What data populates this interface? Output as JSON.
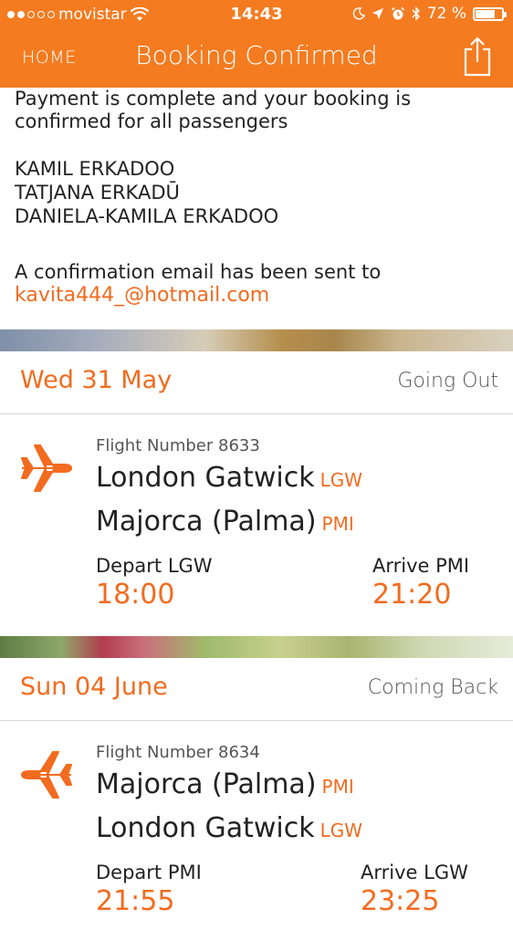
{
  "status_bar": {
    "carrier": "movistar",
    "time": "14:43",
    "battery": "72 %"
  },
  "nav": {
    "home_label": "HOME",
    "title": "Booking Confirmed"
  },
  "confirmation": {
    "message": "Payment is complete and your booking is confirmed for all passengers",
    "passengers": [
      "KAMIL ERKADOO",
      "TATJANA ERKADŪ",
      "DANIELA-KAMILA ERKADOO"
    ],
    "email_notice": "A confirmation email has been sent to",
    "email": "kavita444_@hotmail.com"
  },
  "flights": [
    {
      "date": "Wed 31 May",
      "direction": "Going Out",
      "flight_number": "Flight Number 8633",
      "from_name": "London Gatwick",
      "from_code": "LGW",
      "to_name": "Majorca (Palma)",
      "to_code": "PMI",
      "depart_label": "Depart LGW",
      "depart_time": "18:00",
      "arrive_label": "Arrive PMI",
      "arrive_time": "21:20"
    },
    {
      "date": "Sun 04 June",
      "direction": "Coming Back",
      "flight_number": "Flight Number 8634",
      "from_name": "Majorca (Palma)",
      "from_code": "PMI",
      "to_name": "London Gatwick",
      "to_code": "LGW",
      "depart_label": "Depart PMI",
      "depart_time": "21:55",
      "arrive_label": "Arrive LGW",
      "arrive_time": "23:25"
    }
  ],
  "colors": {
    "accent": "#f47b20",
    "accent_text": "#f26b1f"
  }
}
